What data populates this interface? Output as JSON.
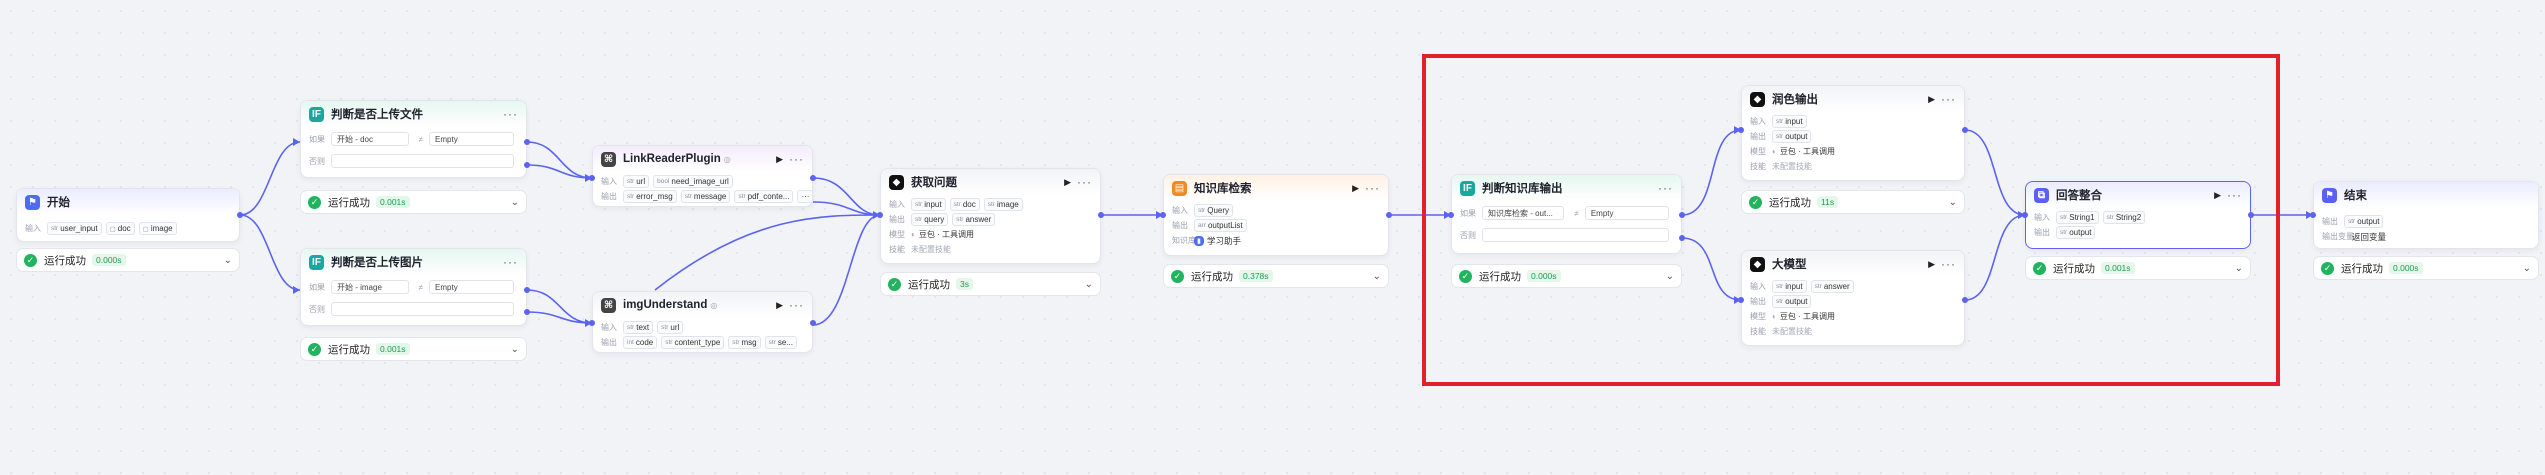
{
  "colors": {
    "accent": "#5b63f0",
    "success": "#22b35e",
    "highlight": "#e0222a"
  },
  "labels": {
    "input": "输入",
    "output": "输出",
    "model": "模型",
    "condition": "如果",
    "else": "否则",
    "skills": "技能",
    "kb": "知识库",
    "output_var": "输出变量"
  },
  "status_text": "运行成功",
  "nodes": {
    "start": {
      "title": "开始",
      "icon": "start-icon",
      "inputs": [
        "user_input",
        "doc",
        "image"
      ],
      "time": "0.000s"
    },
    "cond_file": {
      "title": "判断是否上传文件",
      "icon": "condition-icon",
      "if_var": "开始 - doc",
      "op": "≠",
      "value": "Empty",
      "time": "0.001s"
    },
    "cond_img": {
      "title": "判断是否上传图片",
      "icon": "condition-icon",
      "if_var": "开始 - image",
      "op": "≠",
      "value": "Empty",
      "time": "0.001s"
    },
    "linkreader": {
      "title": "LinkReaderPlugin",
      "icon": "plugin-icon",
      "inputs": [
        "url",
        "need_image_url"
      ],
      "outputs": [
        "error_msg",
        "message",
        "pdf_conte..."
      ]
    },
    "imgunderstand": {
      "title": "imgUnderstand",
      "icon": "plugin-icon",
      "inputs": [
        "text",
        "url"
      ],
      "outputs": [
        "code",
        "content_type",
        "msg",
        "se..."
      ]
    },
    "get_question": {
      "title": "获取问题",
      "icon": "llm-icon",
      "inputs": [
        "input",
        "doc",
        "image"
      ],
      "outputs": [
        "query",
        "answer"
      ],
      "model": "豆包 · 工具调用",
      "skills": "未配置技能",
      "time": "3s"
    },
    "kb_search": {
      "title": "知识库检索",
      "icon": "kb-icon",
      "inputs": [
        "Query"
      ],
      "outputs": [
        "outputList"
      ],
      "kb": "学习助手",
      "time": "0.378s"
    },
    "cond_kb": {
      "title": "判断知识库输出",
      "icon": "condition-icon",
      "if_var": "知识库检索 - out...",
      "op": "≠",
      "value": "Empty",
      "time": "0.000s"
    },
    "polish": {
      "title": "润色输出",
      "icon": "llm-icon",
      "inputs": [
        "input"
      ],
      "outputs": [
        "output"
      ],
      "model": "豆包 · 工具调用",
      "skills": "未配置技能",
      "time": "11s"
    },
    "bigmodel": {
      "title": "大模型",
      "icon": "llm-icon",
      "inputs": [
        "input",
        "answer"
      ],
      "outputs": [
        "output"
      ],
      "model": "豆包 · 工具调用",
      "skills": "未配置技能"
    },
    "merge": {
      "title": "回答整合",
      "icon": "merge-icon",
      "inputs": [
        "String1",
        "String2"
      ],
      "outputs": [
        "output"
      ],
      "time": "0.001s"
    },
    "end": {
      "title": "结束",
      "icon": "end-icon",
      "outputs": [
        "output"
      ],
      "output_var": "返回变量",
      "time": "0.000s"
    }
  }
}
